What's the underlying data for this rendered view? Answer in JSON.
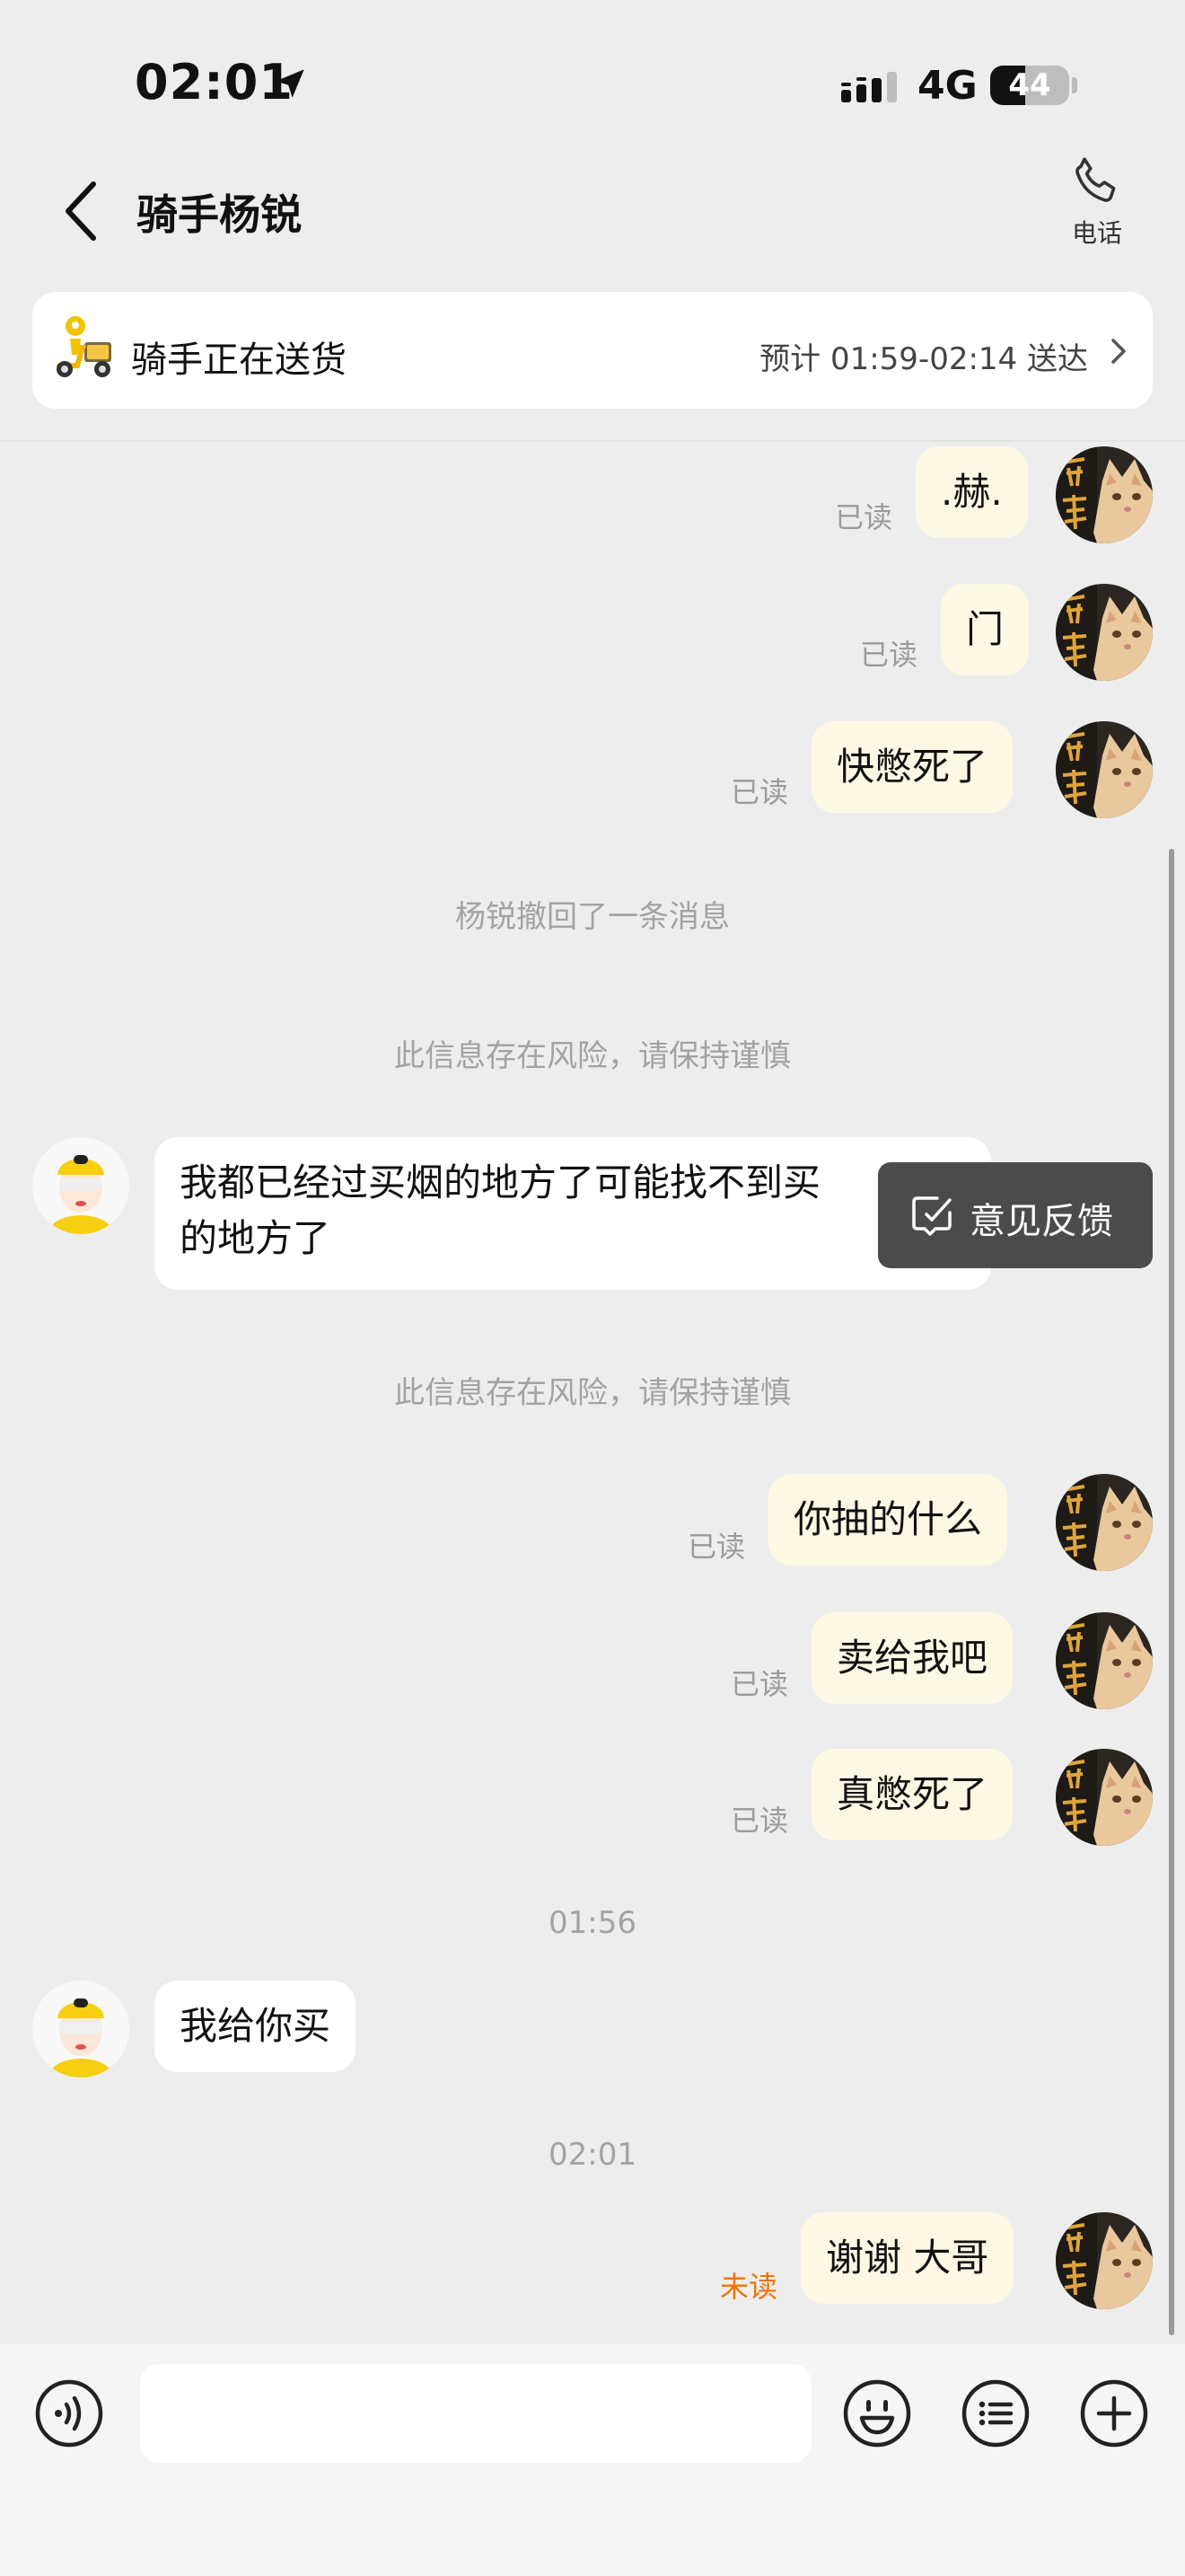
{
  "status": {
    "time": "02:01",
    "network": "4G",
    "battery_level": "44",
    "battery_fraction": 0.44
  },
  "header": {
    "title": "骑手杨锐",
    "phone_label": "电话"
  },
  "delivery": {
    "status": "骑手正在送货",
    "eta": "预计 01:59-02:14 送达"
  },
  "receipts": {
    "read": "已读",
    "unread": "未读"
  },
  "messages": {
    "m1": ".赫.",
    "m2": "门",
    "m3": "快憋死了",
    "sys_recall": "杨锐撤回了一条消息",
    "sys_risk": "此信息存在风险，请保持谨慎",
    "rider_msg1_line1": "我都已经过买烟的地方了可能找不到买",
    "rider_msg1_line2": "的地方了",
    "m4": "你抽的什么",
    "m5": "卖给我吧",
    "m6": "真憋死了",
    "time1": "01:56",
    "rider_msg2": "我给你买",
    "time2": "02:01",
    "m7": "谢谢 大哥"
  },
  "feedback": {
    "label": "意见反馈"
  },
  "composer": {
    "placeholder": ""
  },
  "colors": {
    "my_bubble": "#fdf8e4",
    "unread": "#f07300",
    "background": "#ededed"
  },
  "icons": [
    "location-arrow-icon",
    "signal-icon",
    "back-icon",
    "phone-icon",
    "scooter-icon",
    "chevron-right-icon",
    "feedback-icon",
    "voice-icon",
    "emoji-icon",
    "list-icon",
    "plus-icon"
  ]
}
